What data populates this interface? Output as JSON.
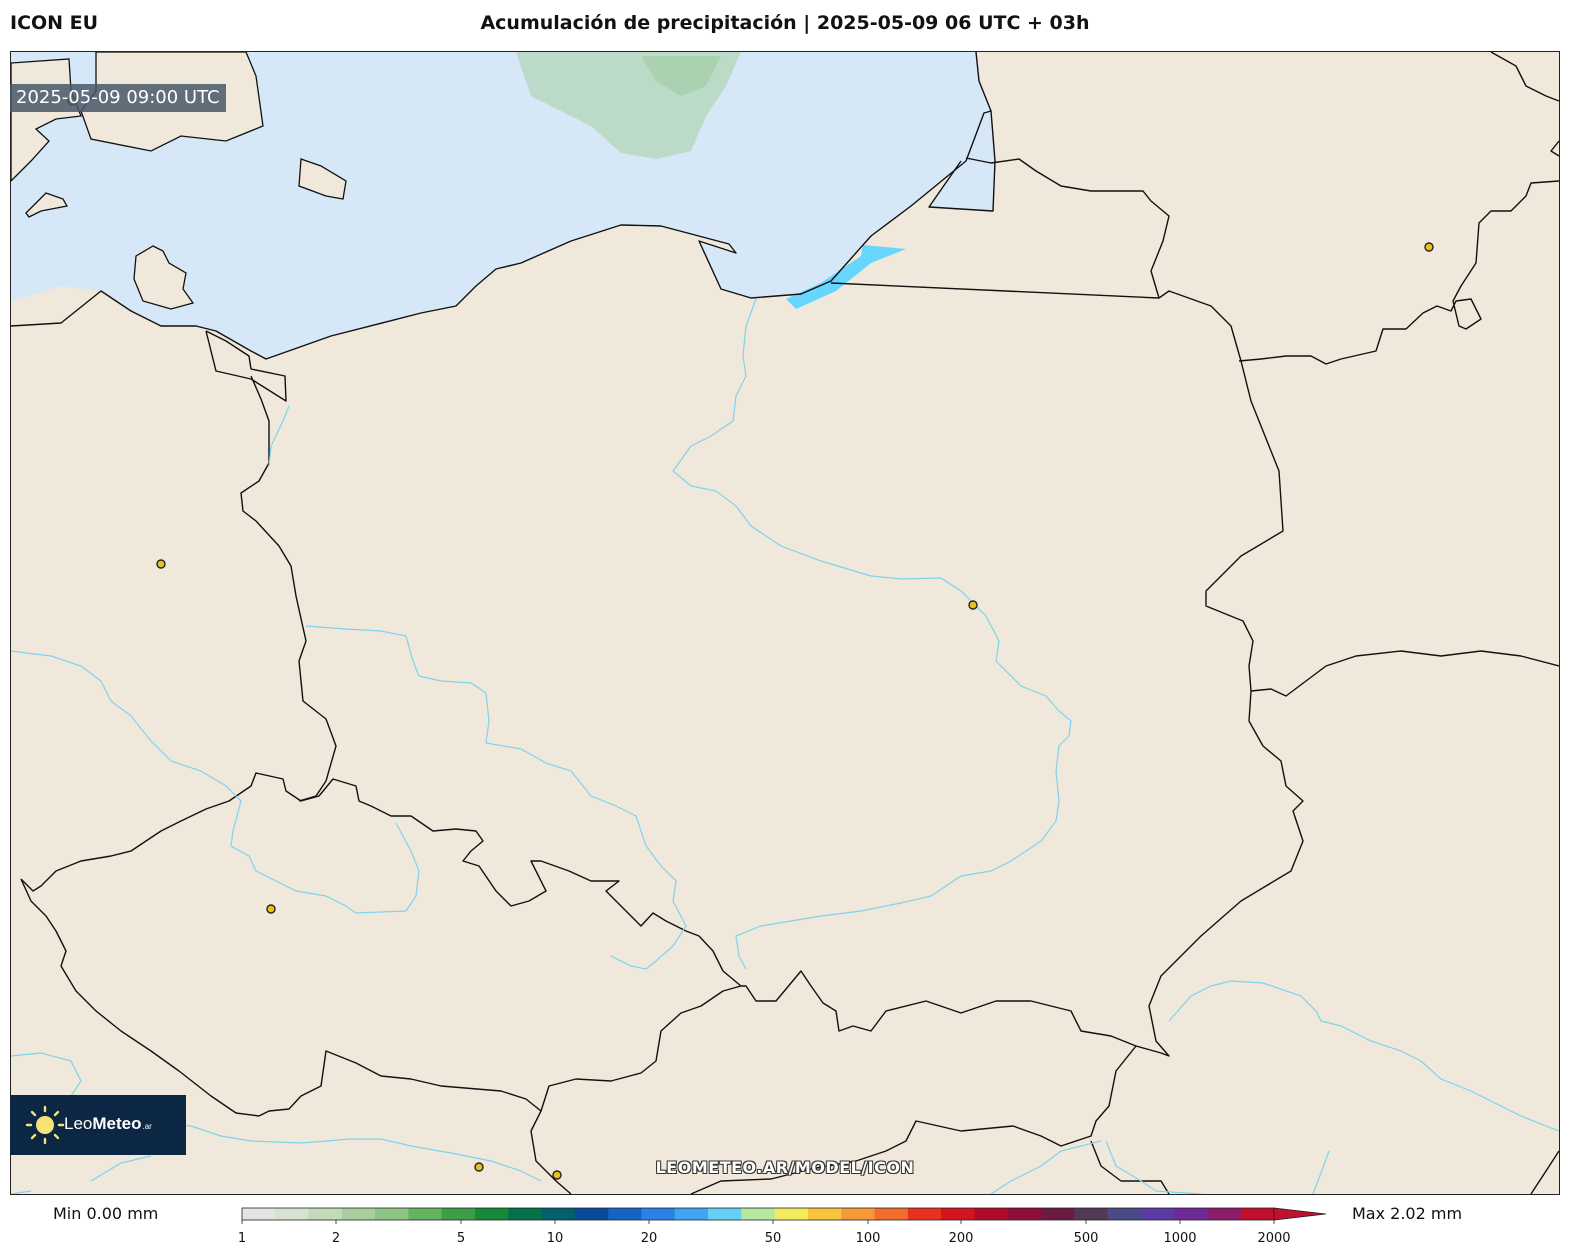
{
  "header": {
    "model": "ICON EU",
    "title": "Acumulación de precipitación | 2025-05-09 06 UTC + 03h"
  },
  "map": {
    "valid_time": "2025-05-09 09:00 UTC",
    "watermark": "LEOMETEO.AR/MODEL/ICON",
    "land_color": "#f0e8da",
    "sea_color": "#d6e8f7",
    "river_color": "#7fd3ee",
    "border_color": "#111111",
    "lagoon_color": "#66d6ff",
    "city_marker_color": "#e8c11c",
    "precipitation_patch_color": "#a8d0a8"
  },
  "logo": {
    "name_light": "Leo",
    "name_bold": "Meteo",
    "suffix": ".ar"
  },
  "colorbar": {
    "min_label": "Min 0.00 mm",
    "max_label": "Max 2.02 mm",
    "ticks": [
      "1",
      "2",
      "5",
      "10",
      "20",
      "50",
      "100",
      "200",
      "500",
      "1000",
      "2000"
    ],
    "colors": [
      "#e4e4e4",
      "#d8e2d0",
      "#c3dbb9",
      "#a9cf9f",
      "#8cc484",
      "#63b35f",
      "#3c9e46",
      "#158a39",
      "#05704a",
      "#035f6b",
      "#074b9a",
      "#1663c8",
      "#2a82e6",
      "#3fa6f5",
      "#63d0f7",
      "#b8e8a0",
      "#f4ec5c",
      "#f7c43e",
      "#f69a38",
      "#f26c2d",
      "#e8321f",
      "#d3131e",
      "#b00b2a",
      "#8f0f3a",
      "#6b1a44",
      "#533a53",
      "#4a4a86",
      "#5a3aa5",
      "#6e2a97",
      "#8a1a6a",
      "#c0102e"
    ]
  }
}
